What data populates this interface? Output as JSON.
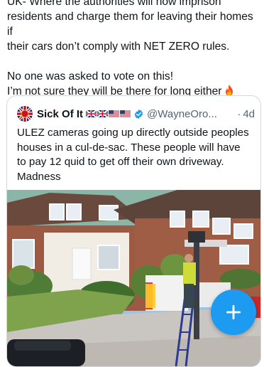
{
  "post": {
    "line1": "UK- Where the authorities will now imprison",
    "line2": "residents and charge them for leaving their homes if",
    "line3": "their cars don’t comply with NET ZERO rules.",
    "line4": "No one was asked to vote on this!",
    "line5": "I’m not sure they will be there for long either"
  },
  "quote": {
    "display_name": "Sick Of It",
    "handle": "@WayneOro...",
    "separator": "·",
    "time": "4d",
    "line1": "ULEZ cameras going up directly outside peoples",
    "line2": "houses in a cul-de-sac. These people will have",
    "line3": "to pay 12 quid to get off their own driveway.",
    "line4": "Madness"
  },
  "icons": {
    "fire": "fire-emoji-icon",
    "verified": "verified-badge-icon",
    "compose": "plus-icon",
    "avatar": "union-jack-emblem-icon"
  },
  "colors": {
    "accent": "#1d9bf0",
    "text": "#0f1419",
    "muted": "#536471",
    "border": "#cfd9de"
  }
}
